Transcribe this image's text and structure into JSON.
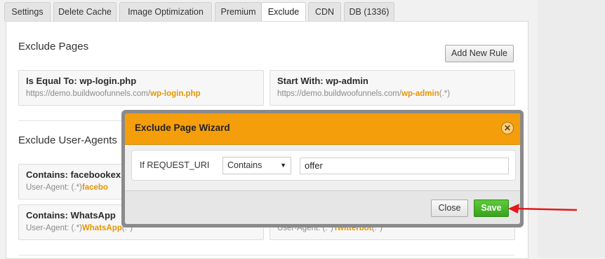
{
  "tabs": [
    "Settings",
    "Delete Cache",
    "Image Optimization",
    "Premium",
    "Exclude",
    "CDN",
    "DB (1336)"
  ],
  "active_tab": "Exclude",
  "exclude_pages": {
    "title": "Exclude Pages",
    "add_button": "Add New Rule",
    "rules": [
      {
        "title": "Is Equal To: wp-login.php",
        "url_prefix": "https://demo.buildwoofunnels.com/",
        "url_highlight": "wp-login.php",
        "url_suffix": ""
      },
      {
        "title": "Start With: wp-admin",
        "url_prefix": "https://demo.buildwoofunnels.com/",
        "url_highlight": "wp-admin",
        "url_suffix": "(.*)"
      }
    ]
  },
  "exclude_user_agents": {
    "title": "Exclude User-Agents",
    "rules": [
      {
        "title": "Contains: facebookex",
        "ua_prefix": "User-Agent: (.*)",
        "ua_highlight": "facebo",
        "ua_suffix": ""
      },
      {
        "title": "Contains: WhatsApp",
        "ua_prefix": "User-Agent: (.*)",
        "ua_highlight": "WhatsApp",
        "ua_suffix": "(.*)"
      },
      {
        "ua_prefix": "User-Agent: (.*)",
        "ua_highlight": "Twitterbot",
        "ua_suffix": "(.*)"
      }
    ]
  },
  "modal": {
    "title": "Exclude Page Wizard",
    "condition_label": "If REQUEST_URI",
    "operator_value": "Contains",
    "value_input": "offer",
    "close_label": "Close",
    "save_label": "Save"
  },
  "colors": {
    "accent_orange": "#f59e0b",
    "save_green": "#39a21d",
    "highlight": "#e69500",
    "arrow_red": "#e3191b"
  }
}
